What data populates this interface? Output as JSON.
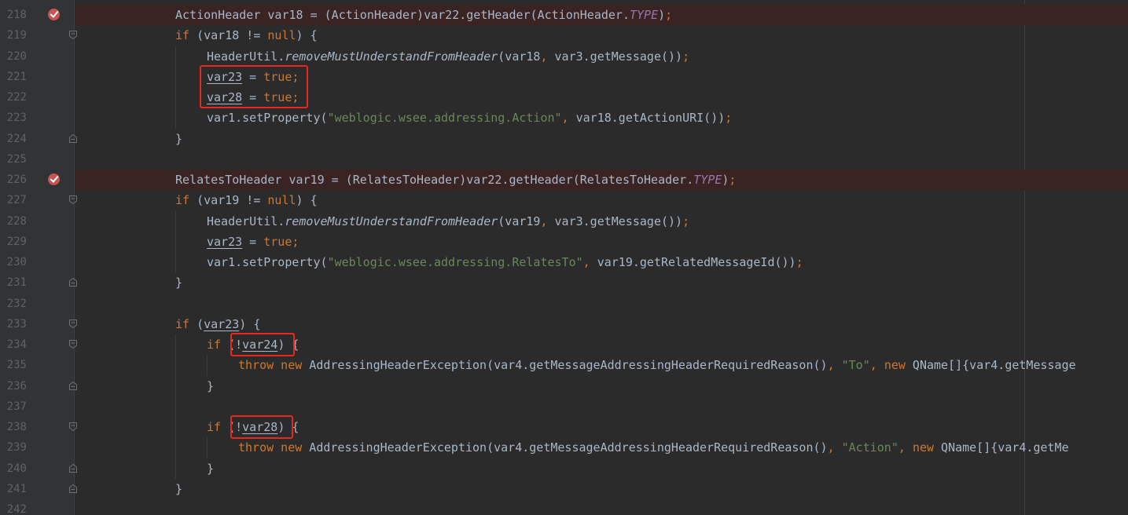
{
  "editor": {
    "lines": [
      {
        "n": "218",
        "breakpoint": true,
        "fold": false,
        "indent": 0,
        "tokens": [
          {
            "t": "ActionHeader ",
            "c": "id"
          },
          {
            "t": "var18",
            "c": "id"
          },
          {
            "t": " = (ActionHeader)",
            "c": "id"
          },
          {
            "t": "var22",
            "c": "id"
          },
          {
            "t": ".getHeader(ActionHeader.",
            "c": "id"
          },
          {
            "t": "TYPE",
            "c": "const"
          },
          {
            "t": ")",
            "c": "id"
          },
          {
            "t": ";",
            "c": "kw"
          }
        ]
      },
      {
        "n": "219",
        "breakpoint": false,
        "fold": "open",
        "indent": 0,
        "tokens": [
          {
            "t": "if",
            "c": "kw"
          },
          {
            "t": " (var18 != ",
            "c": "id"
          },
          {
            "t": "null",
            "c": "kw"
          },
          {
            "t": ") {",
            "c": "id"
          }
        ]
      },
      {
        "n": "220",
        "breakpoint": false,
        "fold": false,
        "indent": 1,
        "tokens": [
          {
            "t": "HeaderUtil.",
            "c": "id"
          },
          {
            "t": "removeMustUnderstandFromHeader",
            "c": "mstatic"
          },
          {
            "t": "(var18",
            "c": "id"
          },
          {
            "t": ", ",
            "c": "kw"
          },
          {
            "t": "var3.getMessage())",
            "c": "id"
          },
          {
            "t": ";",
            "c": "kw"
          }
        ]
      },
      {
        "n": "221",
        "breakpoint": false,
        "fold": false,
        "indent": 1,
        "tokens": [
          {
            "t": "var23",
            "c": "uvar"
          },
          {
            "t": " = ",
            "c": "id"
          },
          {
            "t": "true",
            "c": "kw"
          },
          {
            "t": ";",
            "c": "kw"
          }
        ]
      },
      {
        "n": "222",
        "breakpoint": false,
        "fold": false,
        "indent": 1,
        "tokens": [
          {
            "t": "var28",
            "c": "uvar"
          },
          {
            "t": " = ",
            "c": "id"
          },
          {
            "t": "true",
            "c": "kw"
          },
          {
            "t": ";",
            "c": "kw"
          }
        ]
      },
      {
        "n": "223",
        "breakpoint": false,
        "fold": false,
        "indent": 1,
        "tokens": [
          {
            "t": "var1.setProperty(",
            "c": "id"
          },
          {
            "t": "\"weblogic.wsee.addressing.Action\"",
            "c": "str"
          },
          {
            "t": ", ",
            "c": "kw"
          },
          {
            "t": "var18.getActionURI())",
            "c": "id"
          },
          {
            "t": ";",
            "c": "kw"
          }
        ]
      },
      {
        "n": "224",
        "breakpoint": false,
        "fold": "close",
        "indent": 0,
        "tokens": [
          {
            "t": "}",
            "c": "id"
          }
        ]
      },
      {
        "n": "225",
        "breakpoint": false,
        "fold": false,
        "indent": 0,
        "tokens": []
      },
      {
        "n": "226",
        "breakpoint": true,
        "fold": false,
        "indent": 0,
        "tokens": [
          {
            "t": "RelatesToHeader var19 = (RelatesToHeader)var22.getHeader(RelatesToHeader.",
            "c": "id"
          },
          {
            "t": "TYPE",
            "c": "const"
          },
          {
            "t": ")",
            "c": "id"
          },
          {
            "t": ";",
            "c": "kw"
          }
        ]
      },
      {
        "n": "227",
        "breakpoint": false,
        "fold": "open",
        "indent": 0,
        "tokens": [
          {
            "t": "if",
            "c": "kw"
          },
          {
            "t": " (var19 != ",
            "c": "id"
          },
          {
            "t": "null",
            "c": "kw"
          },
          {
            "t": ") {",
            "c": "id"
          }
        ]
      },
      {
        "n": "228",
        "breakpoint": false,
        "fold": false,
        "indent": 1,
        "tokens": [
          {
            "t": "HeaderUtil.",
            "c": "id"
          },
          {
            "t": "removeMustUnderstandFromHeader",
            "c": "mstatic"
          },
          {
            "t": "(var19",
            "c": "id"
          },
          {
            "t": ", ",
            "c": "kw"
          },
          {
            "t": "var3.getMessage())",
            "c": "id"
          },
          {
            "t": ";",
            "c": "kw"
          }
        ]
      },
      {
        "n": "229",
        "breakpoint": false,
        "fold": false,
        "indent": 1,
        "tokens": [
          {
            "t": "var23",
            "c": "uvar"
          },
          {
            "t": " = ",
            "c": "id"
          },
          {
            "t": "true",
            "c": "kw"
          },
          {
            "t": ";",
            "c": "kw"
          }
        ]
      },
      {
        "n": "230",
        "breakpoint": false,
        "fold": false,
        "indent": 1,
        "tokens": [
          {
            "t": "var1.setProperty(",
            "c": "id"
          },
          {
            "t": "\"weblogic.wsee.addressing.RelatesTo\"",
            "c": "str"
          },
          {
            "t": ", ",
            "c": "kw"
          },
          {
            "t": "var19.getRelatedMessageId())",
            "c": "id"
          },
          {
            "t": ";",
            "c": "kw"
          }
        ]
      },
      {
        "n": "231",
        "breakpoint": false,
        "fold": "close",
        "indent": 0,
        "tokens": [
          {
            "t": "}",
            "c": "id"
          }
        ]
      },
      {
        "n": "232",
        "breakpoint": false,
        "fold": false,
        "indent": 0,
        "tokens": []
      },
      {
        "n": "233",
        "breakpoint": false,
        "fold": "open",
        "indent": 0,
        "tokens": [
          {
            "t": "if",
            "c": "kw"
          },
          {
            "t": " (",
            "c": "id"
          },
          {
            "t": "var23",
            "c": "uvar"
          },
          {
            "t": ") {",
            "c": "id"
          }
        ]
      },
      {
        "n": "234",
        "breakpoint": false,
        "fold": "open",
        "indent": 1,
        "tokens": [
          {
            "t": "if",
            "c": "kw"
          },
          {
            "t": " (!",
            "c": "id"
          },
          {
            "t": "var24",
            "c": "uvar"
          },
          {
            "t": ") {",
            "c": "id"
          }
        ]
      },
      {
        "n": "235",
        "breakpoint": false,
        "fold": false,
        "indent": 2,
        "tokens": [
          {
            "t": "throw new",
            "c": "kw"
          },
          {
            "t": " AddressingHeaderException(var4.getMessageAddressingHeaderRequiredReason()",
            "c": "id"
          },
          {
            "t": ", ",
            "c": "kw"
          },
          {
            "t": "\"To\"",
            "c": "str"
          },
          {
            "t": ", ",
            "c": "kw"
          },
          {
            "t": "new",
            "c": "kw"
          },
          {
            "t": " QName[]{var4.getMessage",
            "c": "id"
          }
        ]
      },
      {
        "n": "236",
        "breakpoint": false,
        "fold": "close",
        "indent": 1,
        "tokens": [
          {
            "t": "}",
            "c": "id"
          }
        ]
      },
      {
        "n": "237",
        "breakpoint": false,
        "fold": false,
        "indent": 0,
        "tokens": []
      },
      {
        "n": "238",
        "breakpoint": false,
        "fold": "open",
        "indent": 1,
        "tokens": [
          {
            "t": "if",
            "c": "kw"
          },
          {
            "t": " (!",
            "c": "id"
          },
          {
            "t": "var28",
            "c": "uvar"
          },
          {
            "t": ") {",
            "c": "id"
          }
        ]
      },
      {
        "n": "239",
        "breakpoint": false,
        "fold": false,
        "indent": 2,
        "tokens": [
          {
            "t": "throw new",
            "c": "kw"
          },
          {
            "t": " AddressingHeaderException(var4.getMessageAddressingHeaderRequiredReason()",
            "c": "id"
          },
          {
            "t": ", ",
            "c": "kw"
          },
          {
            "t": "\"Action\"",
            "c": "str"
          },
          {
            "t": ", ",
            "c": "kw"
          },
          {
            "t": "new",
            "c": "kw"
          },
          {
            "t": " QName[]{var4.getMe",
            "c": "id"
          }
        ]
      },
      {
        "n": "240",
        "breakpoint": false,
        "fold": "close",
        "indent": 1,
        "tokens": [
          {
            "t": "}",
            "c": "id"
          }
        ]
      },
      {
        "n": "241",
        "breakpoint": false,
        "fold": "close",
        "indent": 0,
        "tokens": [
          {
            "t": "}",
            "c": "id"
          }
        ]
      },
      {
        "n": "242",
        "breakpoint": false,
        "fold": false,
        "indent": 0,
        "tokens": []
      }
    ],
    "highlights": [
      {
        "id": "assign-true-box",
        "first_line": "221",
        "last_line": "222"
      },
      {
        "id": "not-var24-box",
        "line": "234"
      },
      {
        "id": "not-var28-box",
        "line": "238"
      }
    ],
    "colors": {
      "background": "#2b2b2b",
      "keyword": "#cc7832",
      "string": "#6a8759",
      "constant": "#9876aa",
      "identifier": "#a9b7c6",
      "line_number": "#606366",
      "breakpoint": "#c75450",
      "highlight_box": "#e8281e"
    }
  }
}
